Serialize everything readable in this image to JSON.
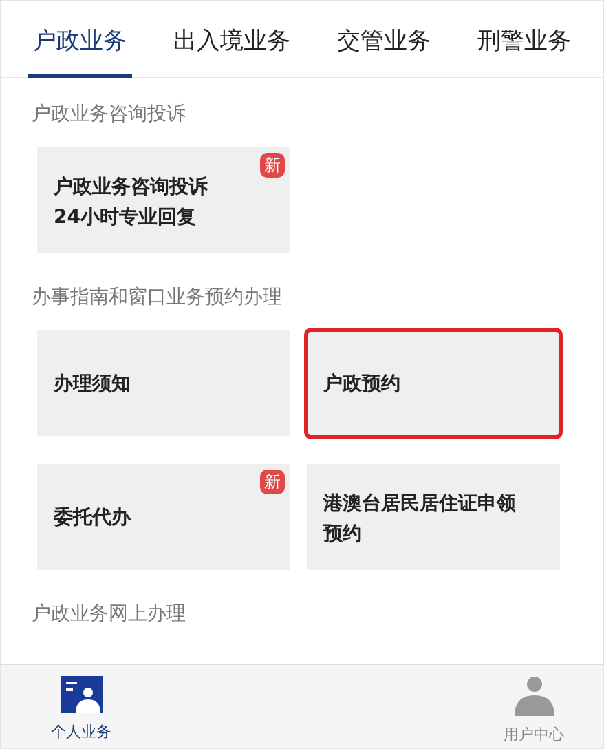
{
  "tabs": [
    {
      "label": "户政业务",
      "selected": true
    },
    {
      "label": "出入境业务",
      "selected": false
    },
    {
      "label": "交管业务",
      "selected": false
    },
    {
      "label": "刑警业务",
      "selected": false
    }
  ],
  "sections": [
    {
      "title": "户政业务咨询投诉",
      "cards": [
        {
          "lines": [
            "户政业务咨询投诉",
            "24小时专业回复"
          ],
          "badge": "新",
          "highlighted": false
        }
      ]
    },
    {
      "title": "办事指南和窗口业务预约办理",
      "cards": [
        {
          "lines": [
            "办理须知"
          ],
          "highlighted": false
        },
        {
          "lines": [
            "户政预约"
          ],
          "highlighted": true
        },
        {
          "lines": [
            "委托代办"
          ],
          "badge": "新",
          "highlighted": false
        },
        {
          "lines": [
            "港澳台居民居住证申领",
            "预约"
          ],
          "highlighted": false
        }
      ]
    },
    {
      "title": "户政业务网上办理"
    }
  ],
  "bottom_nav": [
    {
      "label": "个人业务",
      "selected": true,
      "kind": "id-card"
    },
    {
      "label": "用户中心",
      "selected": false,
      "kind": "person"
    }
  ]
}
